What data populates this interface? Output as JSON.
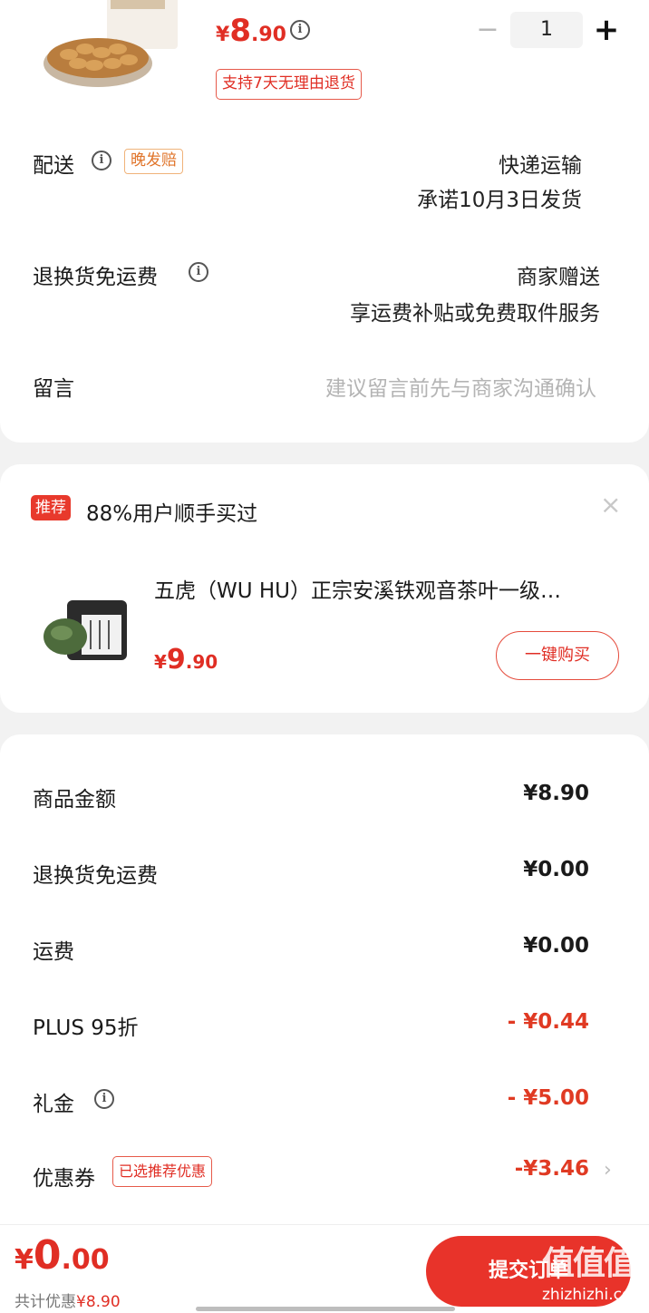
{
  "order": {
    "price_currency": "¥",
    "price_integer": "8",
    "price_decimal": ".90",
    "quantity": "1",
    "return_policy_badge": "支持7天无理由退货",
    "shipping": {
      "label": "配送",
      "late_badge": "晚发赔",
      "method": "快递运输",
      "promise": "承诺10月3日发货"
    },
    "free_return_shipping": {
      "label": "退换货免运费",
      "provider": "商家赠送",
      "service": "享运费补贴或免费取件服务"
    },
    "message": {
      "label": "留言",
      "placeholder": "建议留言前先与商家沟通确认"
    }
  },
  "recommendation": {
    "tag": "推荐",
    "title": "88%用户顺手买过",
    "product_name": "五虎（WU HU）正宗安溪铁观音茶叶一级…",
    "price_currency": "¥",
    "price_integer": "9",
    "price_decimal": ".90",
    "buy_label": "一键购买"
  },
  "summary": {
    "rows": [
      {
        "label": "商品金额",
        "value": "¥8.90"
      },
      {
        "label": "退换货免运费",
        "value": "¥0.00"
      },
      {
        "label": "运费",
        "value": "¥0.00"
      },
      {
        "label": "PLUS 95折",
        "value": "- ¥0.44"
      },
      {
        "label": "礼金",
        "value": "- ¥5.00"
      },
      {
        "label": "优惠券",
        "value": "-¥3.46"
      }
    ],
    "coupon_badge": "已选推荐优惠"
  },
  "bottom": {
    "total_currency": "¥",
    "total_integer": "0",
    "total_decimal": ".00",
    "saving_label": "共计优惠",
    "saving_amount": "¥8.90",
    "submit_label": "提交订单"
  },
  "watermark": {
    "logo": "值值值",
    "url": "zhizhizhi.com"
  },
  "colors": {
    "accent_red": "#e02e24",
    "badge_orange": "#e0742a",
    "placeholder_gray": "#b4b4b4"
  }
}
